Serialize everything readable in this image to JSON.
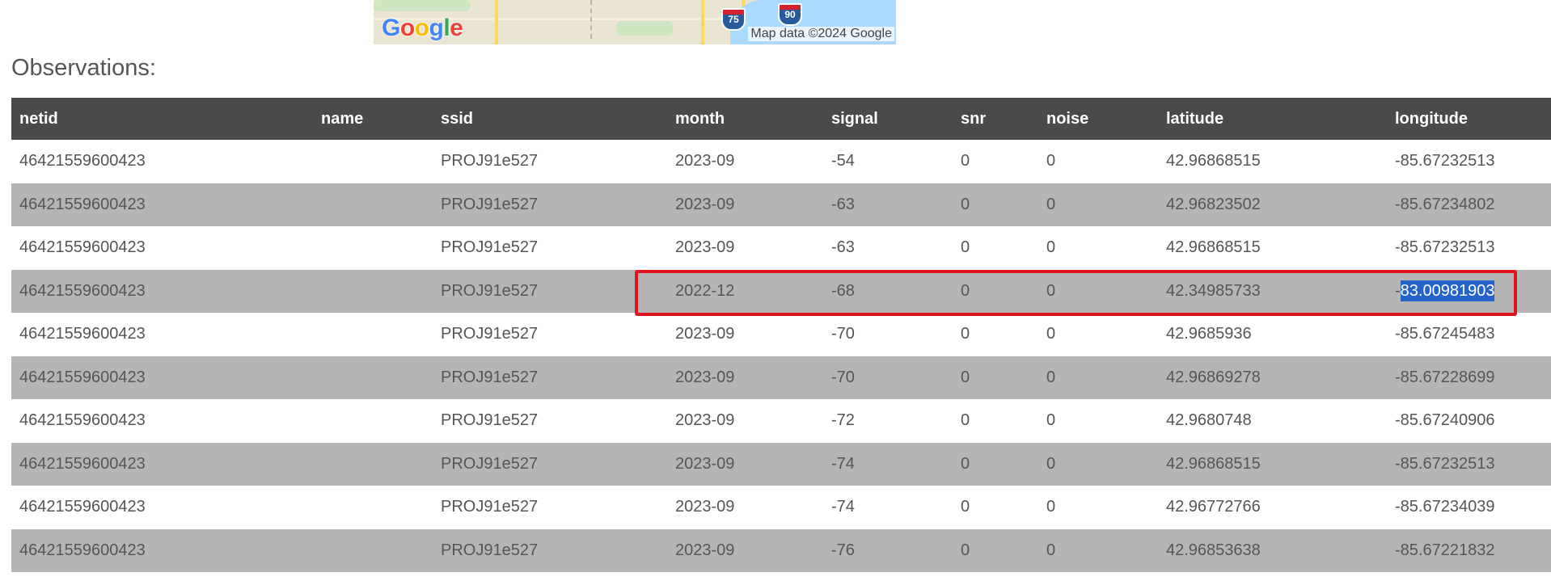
{
  "map": {
    "logo_text": "Google",
    "attribution": "Map data ©2024 Google",
    "shields": [
      "75",
      "90"
    ]
  },
  "heading": "Observations:",
  "table": {
    "columns": [
      "netid",
      "name",
      "ssid",
      "month",
      "signal",
      "snr",
      "noise",
      "latitude",
      "longitude"
    ],
    "rows": [
      [
        "46421559600423",
        "",
        "PROJ91e527",
        "2023-09",
        "-54",
        "0",
        "0",
        "42.96868515",
        "-85.67232513"
      ],
      [
        "46421559600423",
        "",
        "PROJ91e527",
        "2023-09",
        "-63",
        "0",
        "0",
        "42.96823502",
        "-85.67234802"
      ],
      [
        "46421559600423",
        "",
        "PROJ91e527",
        "2023-09",
        "-63",
        "0",
        "0",
        "42.96868515",
        "-85.67232513"
      ],
      [
        "46421559600423",
        "",
        "PROJ91e527",
        "2022-12",
        "-68",
        "0",
        "0",
        "42.34985733",
        "-83.00981903"
      ],
      [
        "46421559600423",
        "",
        "PROJ91e527",
        "2023-09",
        "-70",
        "0",
        "0",
        "42.9685936",
        "-85.67245483"
      ],
      [
        "46421559600423",
        "",
        "PROJ91e527",
        "2023-09",
        "-70",
        "0",
        "0",
        "42.96869278",
        "-85.67228699"
      ],
      [
        "46421559600423",
        "",
        "PROJ91e527",
        "2023-09",
        "-72",
        "0",
        "0",
        "42.9680748",
        "-85.67240906"
      ],
      [
        "46421559600423",
        "",
        "PROJ91e527",
        "2023-09",
        "-74",
        "0",
        "0",
        "42.96868515",
        "-85.67232513"
      ],
      [
        "46421559600423",
        "",
        "PROJ91e527",
        "2023-09",
        "-74",
        "0",
        "0",
        "42.96772766",
        "-85.67234039"
      ],
      [
        "46421559600423",
        "",
        "PROJ91e527",
        "2023-09",
        "-76",
        "0",
        "0",
        "42.96853638",
        "-85.67221832"
      ]
    ],
    "highlighted_row": 3,
    "selected_cell": {
      "row": 3,
      "col": 8,
      "unselected_prefix": "-",
      "selected_text": "83.00981903"
    }
  },
  "colors": {
    "header_bg": "#4a4a4a",
    "stripe_bg": "#b5b5b5",
    "highlight_border": "#e0141e",
    "selection_bg": "#2563c9"
  }
}
